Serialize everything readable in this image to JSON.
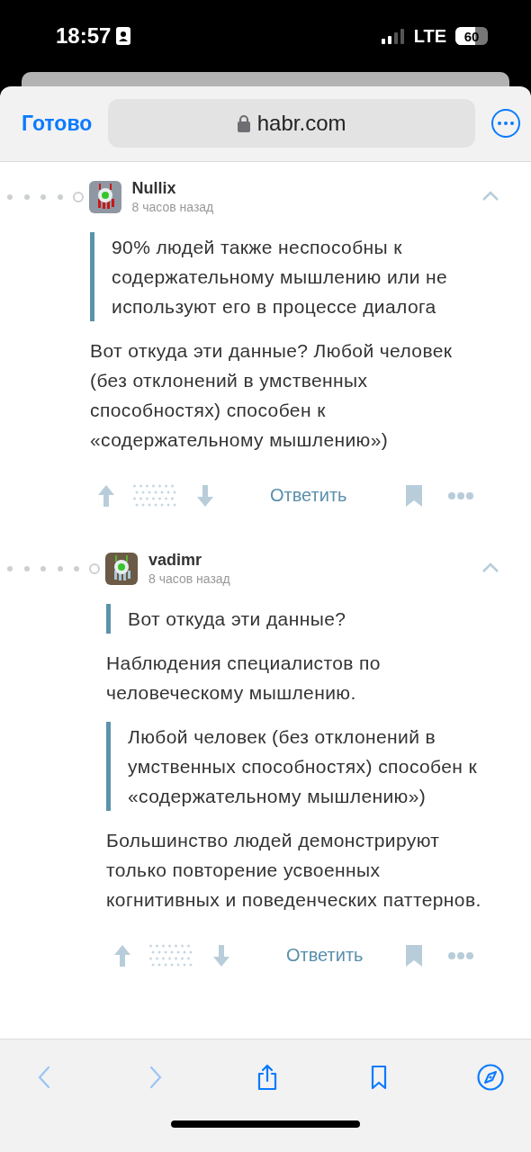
{
  "status_bar": {
    "time": "18:57",
    "network": "LTE",
    "battery": "60"
  },
  "browser": {
    "done": "Готово",
    "url": "habr.com"
  },
  "comments": [
    {
      "author": "Nullix",
      "time": "8 часов назад",
      "expanded": true,
      "blocks": [
        {
          "kind": "quote",
          "text": "90% людей также неспособны к содержательному мышлению или не используют его в процессе диалога"
        },
        {
          "kind": "paragraph",
          "text": "Вот откуда эти данные? Любой человек (без отклонений в умственных способностях) способен к «содержательному мышлению»)"
        }
      ],
      "reply": "Ответить",
      "children": [
        {
          "author": "vadimr",
          "time": "8 часов назад",
          "expanded": true,
          "blocks": [
            {
              "kind": "quote",
              "text": "Вот откуда эти данные?"
            },
            {
              "kind": "paragraph",
              "text": "Наблюдения специалистов по человеческому мышлению."
            },
            {
              "kind": "quote",
              "text": "Любой человек (без отклонений в умственных способностях) способен к «содержательному мышлению»)"
            },
            {
              "kind": "paragraph",
              "text": "Большинство людей демонстрируют только повторение усвоенных когнитивных и поведенческих паттернов."
            }
          ],
          "reply": "Ответить"
        }
      ]
    }
  ],
  "toolbar": [
    {
      "kind": "back",
      "disabled": true
    },
    {
      "kind": "forward",
      "disabled": true
    },
    {
      "kind": "share",
      "disabled": false
    },
    {
      "kind": "bookmarks",
      "disabled": false
    },
    {
      "kind": "compass",
      "disabled": false
    }
  ]
}
